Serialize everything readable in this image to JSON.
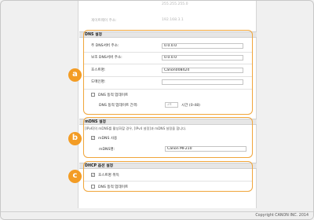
{
  "top": {
    "row1_value": "255.255.255.0",
    "gateway_label": "게이트웨이 주소:",
    "gateway_value": "192.168.3.1"
  },
  "dns": {
    "title": "DNS 설정",
    "primary_label": "주 DNS서버 주소:",
    "primary_value": "0.0.0.0",
    "secondary_label": "보조 DNS서버 주소:",
    "secondary_value": "0.0.0.0",
    "hostname_label": "호스트명:",
    "hostname_value": "Canon008424",
    "domain_label": "도메인명:",
    "domain_value": "",
    "dynamic_update_label": "DNS 동적 업데이트",
    "interval_label": "DNS 동적 업데이트 간격:",
    "interval_value": "24",
    "interval_unit": "시간 (0-48)"
  },
  "mdns": {
    "title": "mDNS 설정",
    "note": "[IPv6]의 mDNS를 활성화할 경우, [IPv4 설정]과 mDNS 설정을 합니다.",
    "use_label": "mDNS 사용",
    "use_checked": "✓",
    "name_label": "mDNS명:",
    "name_value": "Canon MF210"
  },
  "dhcp": {
    "title": "DHCP 옵션 설정",
    "hostname_label": "호스트명 취득",
    "hostname_checked": "✓",
    "dns_update_label": "DNS 동적 업데이트"
  },
  "markers": {
    "a": "a",
    "b": "b",
    "c": "c"
  },
  "footer": {
    "copyright": "Copyright CANON INC. 2014"
  },
  "colors": {
    "accent": "#f39c24",
    "outline": "#f0a53a"
  }
}
